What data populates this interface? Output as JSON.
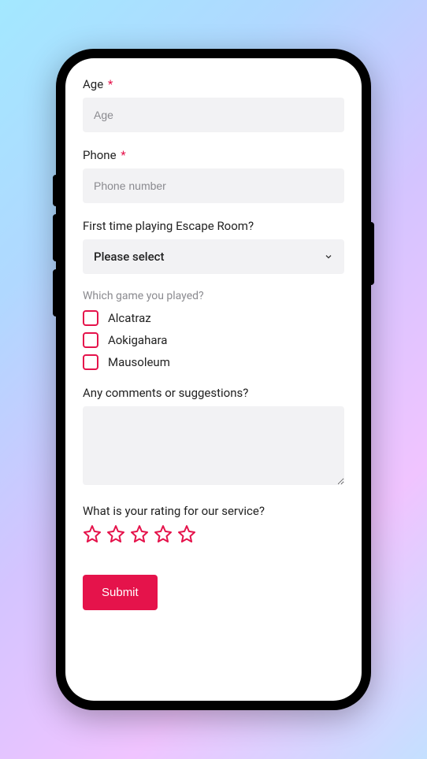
{
  "fields": {
    "age": {
      "label": "Age",
      "required": "*",
      "placeholder": "Age"
    },
    "phone": {
      "label": "Phone",
      "required": "*",
      "placeholder": "Phone number"
    },
    "firstTime": {
      "label": "First time playing Escape Room?",
      "selectText": "Please select"
    },
    "games": {
      "label": "Which game you played?",
      "options": [
        "Alcatraz",
        "Aokigahara",
        "Mausoleum"
      ]
    },
    "comments": {
      "label": "Any comments or suggestions?"
    },
    "rating": {
      "label": "What is your rating for our service?",
      "count": 5
    }
  },
  "submit": "Submit"
}
